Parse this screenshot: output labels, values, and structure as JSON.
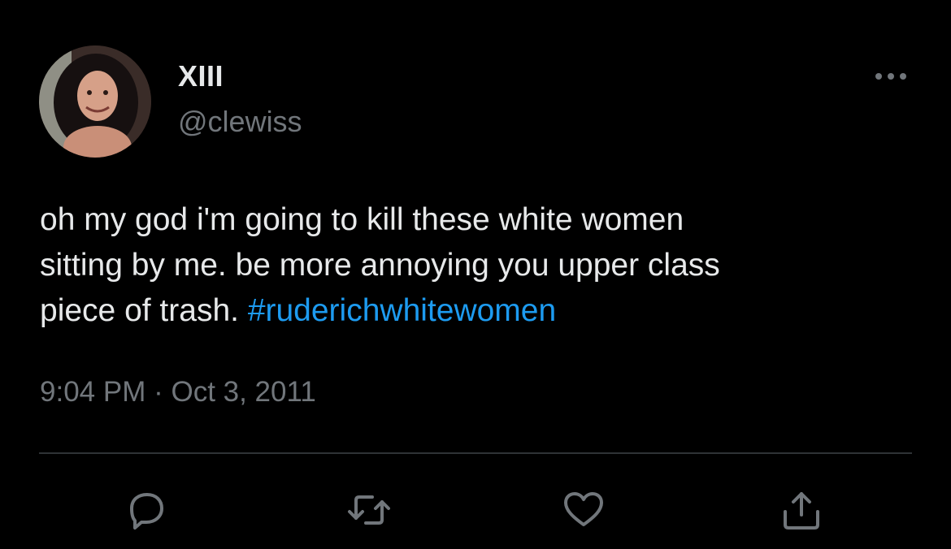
{
  "user": {
    "display_name": "XIII",
    "handle": "@clewiss",
    "avatar_icon": "profile-photo"
  },
  "tweet": {
    "text": "oh my god i'm going to kill these white women\nsitting by me. be more annoying you upper class\npiece of trash. ",
    "hashtag": "#ruderichwhitewomen",
    "time": "9:04 PM",
    "separator": " · ",
    "date": "Oct 3, 2011"
  },
  "icons": {
    "more": "more-options-icon",
    "reply": "reply-icon",
    "retweet": "retweet-icon",
    "like": "like-icon",
    "share": "share-icon"
  },
  "colors": {
    "background": "#000000",
    "text_primary": "#e7e9ea",
    "text_secondary": "#71767b",
    "link": "#1d9bf0",
    "divider": "#2f3336"
  }
}
